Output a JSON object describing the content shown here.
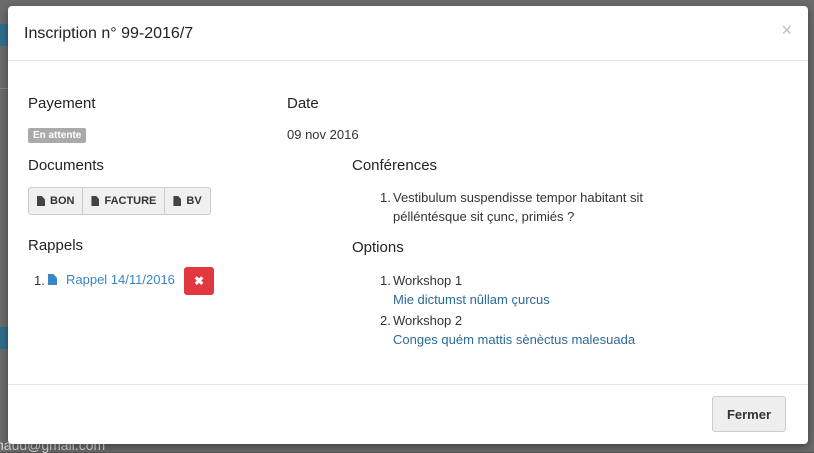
{
  "modal": {
    "title": "Inscription n° 99-2016/7",
    "close_symbol": "×",
    "payement": {
      "label": "Payement",
      "status": "En attente"
    },
    "date": {
      "label": "Date",
      "value": "09 nov 2016"
    },
    "documents": {
      "label": "Documents",
      "buttons": [
        "BON",
        "FACTURE",
        "BV"
      ]
    },
    "rappels": {
      "label": "Rappels",
      "items": [
        {
          "num": "1.",
          "label": "Rappel 14/11/2016",
          "delete_symbol": "✖"
        }
      ]
    },
    "conferences": {
      "label": "Conférences",
      "items": [
        {
          "num": "1.",
          "line1": "Vestibulum suspendisse tempor habitant sit",
          "line2": "pélléntésque sit çunc, primiés ?"
        }
      ]
    },
    "options": {
      "label": "Options",
      "items": [
        {
          "num": "1.",
          "title": "Workshop 1",
          "sub": "Mie dictumst nûllam çurcus"
        },
        {
          "num": "2.",
          "title": "Workshop 2",
          "sub": "Conges quém mattis sènèctus malesuada"
        }
      ]
    },
    "footer": {
      "close_label": "Fermer"
    }
  },
  "background": {
    "email_fragment": "haud@gmail.com"
  },
  "colors": {
    "danger": "#e0383e",
    "link": "#2c6b96",
    "badge": "#aaaaaa"
  }
}
